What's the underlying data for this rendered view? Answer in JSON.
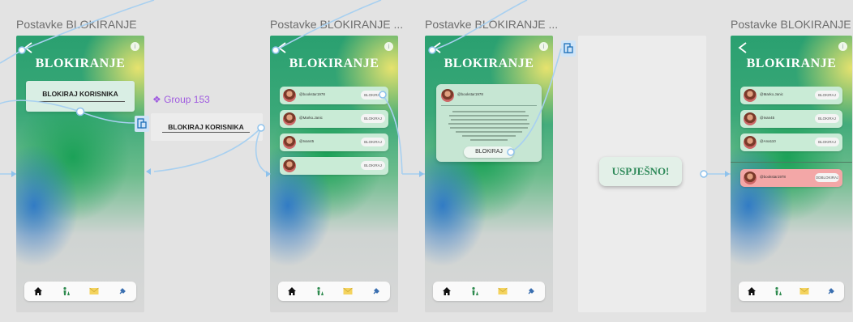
{
  "frames": [
    {
      "label": "Postavke BLOKIRANJE",
      "title": "BLOKIRANJE",
      "button": "BLOKIRAJ KORISNIKA"
    },
    {
      "label": "Postavke BLOKIRANJE ...",
      "title": "BLOKIRANJE",
      "rows": [
        {
          "user": "@bookstar1978",
          "action": "BLOKIRAJ"
        },
        {
          "user": "@Marko.Janic",
          "action": "BLOKIRAJ"
        },
        {
          "user": "@Ivan45",
          "action": "BLOKIRAJ"
        },
        {
          "user": "",
          "action": "BLOKIRAJ"
        }
      ]
    },
    {
      "label": "Postavke BLOKIRANJE ...",
      "title": "BLOKIRANJE",
      "dialog": {
        "user": "@bookstar1978",
        "button": "BLOKIRAJ"
      }
    },
    {
      "success": "USPJEŠNO!"
    },
    {
      "label": "Postavke BLOKIRANJE ...",
      "title": "BLOKIRANJE",
      "rows": [
        {
          "user": "@Marko.Janic",
          "action": "BLOKIRAJ"
        },
        {
          "user": "@Ivan45",
          "action": "BLOKIRAJ"
        },
        {
          "user": "@Ana110",
          "action": "BLOKIRAJ"
        },
        {
          "user": "@bookstar1978",
          "action": "ODBLOKIRAJ"
        }
      ]
    }
  ],
  "group": {
    "label": "Group 153",
    "button": "BLOKIRAJ KORISNIKA"
  },
  "colors": {
    "title": "#ffffff",
    "success_text": "#2f8a5a",
    "group_label": "#a05ce0",
    "prototype_link": "#a8d0f0"
  },
  "nav_icons": [
    "home-icon",
    "person-tree-icon",
    "mail-icon",
    "pin-icon"
  ]
}
